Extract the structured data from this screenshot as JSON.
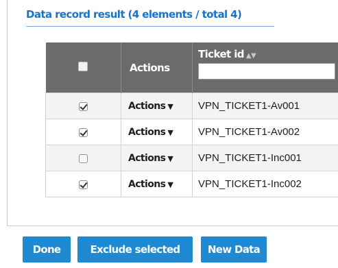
{
  "panel": {
    "title": "Data record result (4 elements / total 4)"
  },
  "table": {
    "headers": {
      "actions": "Actions",
      "ticket_id": "Ticket id",
      "sort_icon": "sort-icon",
      "filter_value": ""
    },
    "rows": [
      {
        "checked": true,
        "actions": "Actions",
        "ticket_id": "VPN_TICKET1-Av001"
      },
      {
        "checked": true,
        "actions": "Actions",
        "ticket_id": "VPN_TICKET1-Av002"
      },
      {
        "checked": false,
        "actions": "Actions",
        "ticket_id": "VPN_TICKET1-Inc001"
      },
      {
        "checked": true,
        "actions": "Actions",
        "ticket_id": "VPN_TICKET1-Inc002"
      }
    ]
  },
  "buttons": {
    "done": "Done",
    "exclude_selected": "Exclude selected",
    "new_data": "New Data"
  },
  "colors": {
    "accent": "#1f8ad1",
    "title": "#1a73c8",
    "header_bg": "#6b6b6b"
  }
}
